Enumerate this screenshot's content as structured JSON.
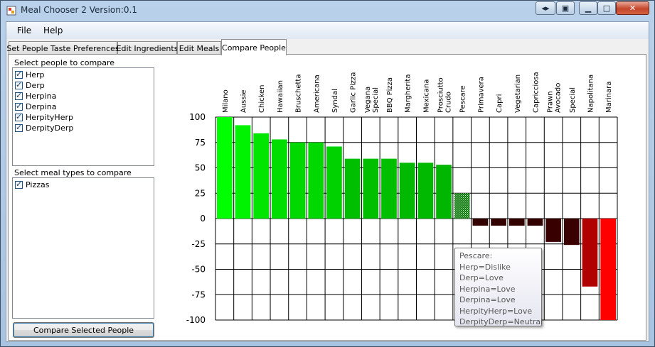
{
  "window": {
    "title": "Meal Chooser 2 Version:0.1"
  },
  "colors": {
    "bar_positive_max": "#00ff00",
    "bar_positive_min": "#006400",
    "bar_negative_mid": "#400000",
    "bar_negative_max": "#ff0000",
    "grid": "#000000"
  },
  "menu": {
    "items": [
      "File",
      "Help"
    ]
  },
  "tabs": [
    "Set People Taste Preferences",
    "Edit Ingredients",
    "Edit Meals",
    "Compare People"
  ],
  "active_tab": "Compare People",
  "people": {
    "label": "Select people to compare",
    "items": [
      {
        "name": "Herp",
        "checked": true
      },
      {
        "name": "Derp",
        "checked": true
      },
      {
        "name": "Herpina",
        "checked": true
      },
      {
        "name": "Derpina",
        "checked": true
      },
      {
        "name": "HerpityHerp",
        "checked": true
      },
      {
        "name": "DerpityDerp",
        "checked": true
      }
    ]
  },
  "meal_types": {
    "label": "Select meal types to compare",
    "items": [
      {
        "name": "Pizzas",
        "checked": true
      }
    ]
  },
  "compare_button": "Compare Selected People",
  "chart_data": {
    "type": "bar",
    "categories": [
      "Milano",
      "Aussie",
      "Chicken",
      "Hawaiian",
      "Bruschetta",
      "Americana",
      "Syndal",
      "Garlic Pizza",
      "Vegana Special",
      "BBQ Pizza",
      "Margherita",
      "Mexicana",
      "Prosciutto Crudo",
      "Pescare",
      "Primavera",
      "Capri",
      "Vegetarian",
      "Capricciosa",
      "Prawn Avocado",
      "Special",
      "Napolitana",
      "Marinara"
    ],
    "category_lines": [
      [
        "Milano"
      ],
      [
        "Aussie"
      ],
      [
        "Chicken"
      ],
      [
        "Hawaiian"
      ],
      [
        "Bruschetta"
      ],
      [
        "Americana"
      ],
      [
        "Syndal"
      ],
      [
        "Garlic Pizza"
      ],
      [
        "Vegana",
        "Special"
      ],
      [
        "BBQ Pizza"
      ],
      [
        "Margherita"
      ],
      [
        "Mexicana"
      ],
      [
        "Prosciutto",
        "Crudo"
      ],
      [
        "Pescare"
      ],
      [
        "Primavera"
      ],
      [
        "Capri"
      ],
      [
        "Vegetarian"
      ],
      [
        "Capricciosa"
      ],
      [
        "Prawn",
        "Avocado"
      ],
      [
        "Special"
      ],
      [
        "Napolitana"
      ],
      [
        "Marinara"
      ]
    ],
    "values": [
      100,
      92,
      84,
      78,
      75,
      75,
      71,
      59,
      59,
      59,
      55,
      55,
      53,
      25,
      -7,
      -7,
      -7,
      -7,
      -23,
      -26,
      -67,
      -100
    ],
    "ylim": [
      -100,
      100
    ],
    "yticks": [
      100,
      75,
      50,
      25,
      0,
      -25,
      -50,
      -75,
      -100
    ],
    "grid": true,
    "hatched_category": "Pescare"
  },
  "tooltip": {
    "lines": [
      "Pescare:",
      "Herp=Dislike",
      "Derp=Love",
      "Herpina=Love",
      "Derpina=Love",
      "HerpityHerp=Love",
      "DerpityDerp=Neutral"
    ]
  }
}
